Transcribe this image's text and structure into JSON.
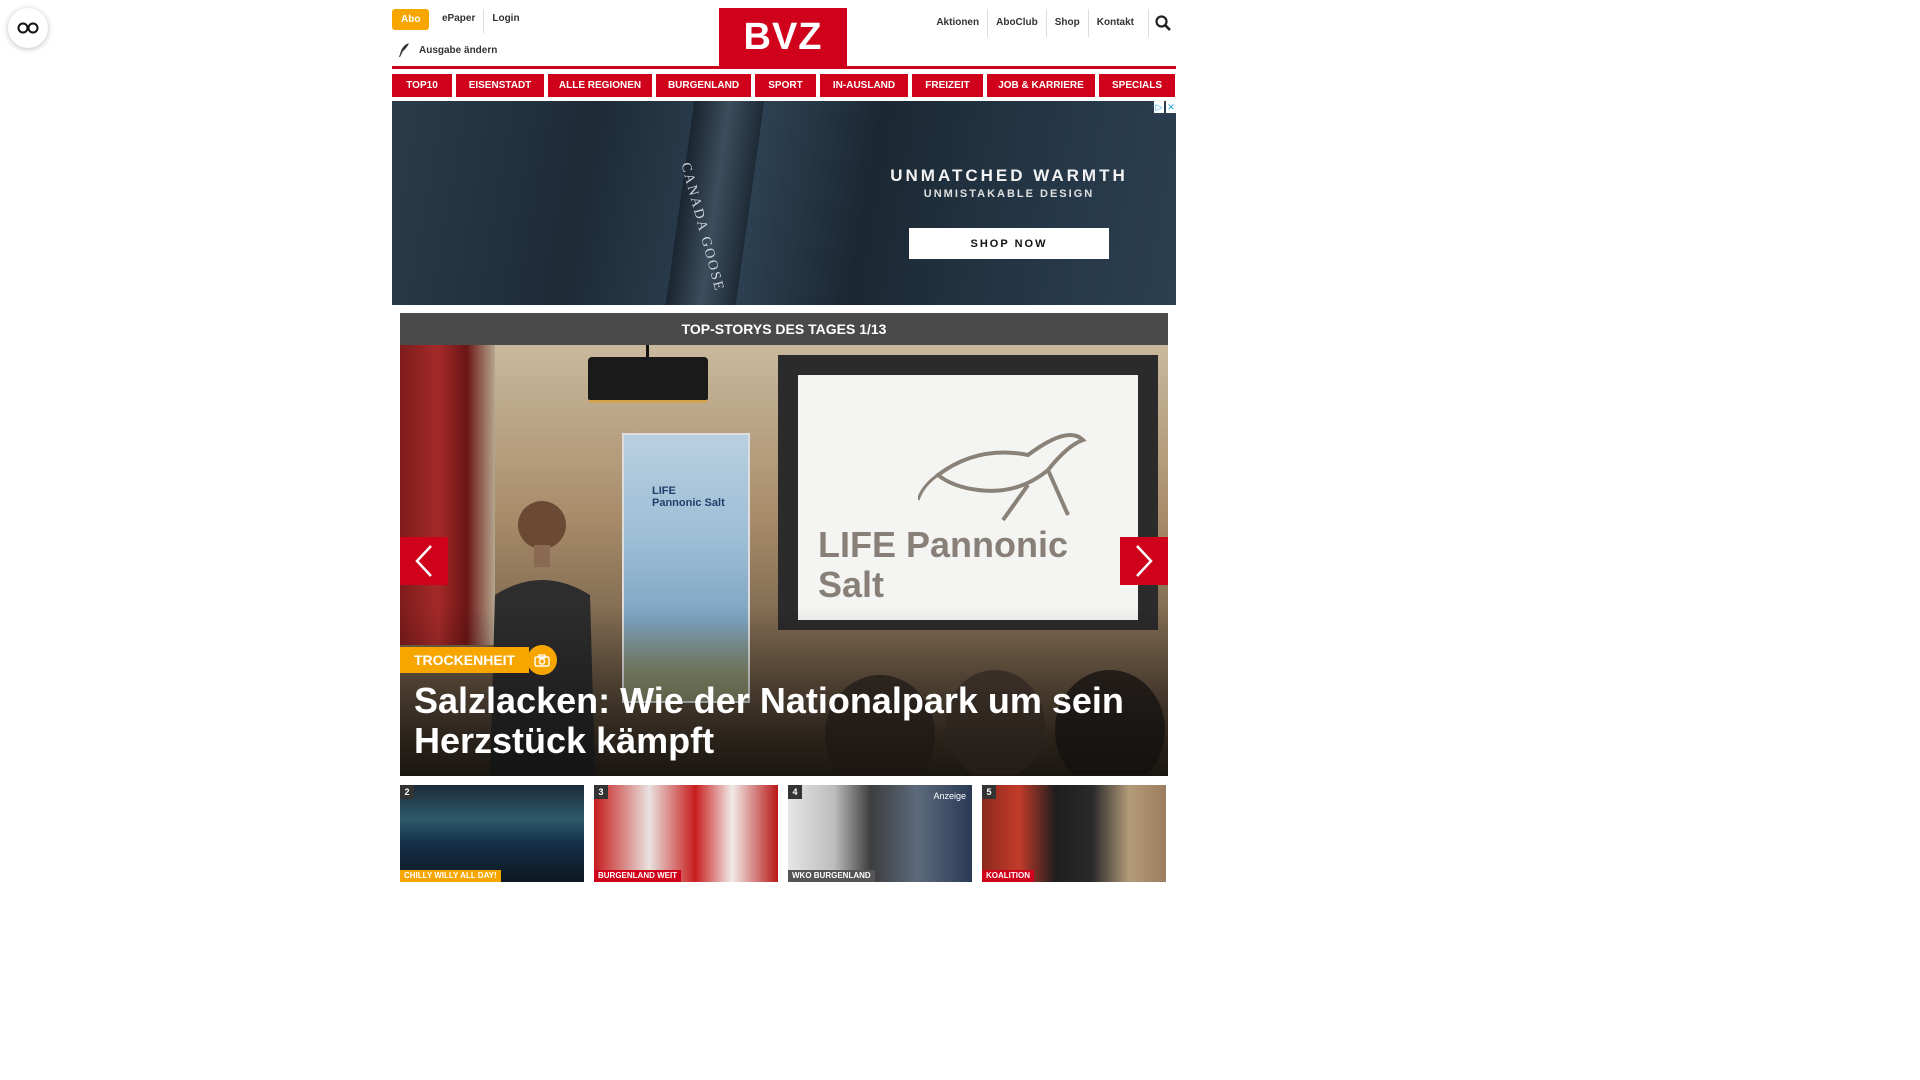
{
  "header": {
    "abo_label": "Abo",
    "epaper_label": "ePaper",
    "login_label": "Login",
    "edition_label": "Ausgabe ändern",
    "logo_text": "BVZ",
    "right_links": [
      "Aktionen",
      "AboClub",
      "Shop",
      "Kontakt"
    ]
  },
  "nav": {
    "items": [
      "TOP10",
      "EISENSTADT",
      "ALLE REGIONEN",
      "BURGENLAND",
      "SPORT",
      "IN-AUSLAND",
      "FREIZEIT",
      "JOB & KARRIERE",
      "SPECIALS"
    ]
  },
  "ad": {
    "brand": "CANADA GOOSE",
    "headline": "UNMATCHED WARMTH",
    "subline": "UNMISTAKABLE DESIGN",
    "cta": "SHOP NOW"
  },
  "stories": {
    "header": "TOP-STORYS DES TAGES 1/13",
    "hero": {
      "category": "TROCKENHEIT",
      "title": "Salzlacken: Wie der Nationalpark um sein Herzstück kämpft",
      "screen_text": "LIFE Pannonic Salt"
    },
    "thumbs": [
      {
        "num": "2",
        "category": "CHILLY WILLY ALL DAY!",
        "cat_color": "#f7a600"
      },
      {
        "num": "3",
        "category": "BURGENLAND WEIT",
        "cat_color": "#d0021b"
      },
      {
        "num": "4",
        "category": "WKO BURGENLAND",
        "cat_color": "#555555",
        "anzeige": "Anzeige"
      },
      {
        "num": "5",
        "category": "KOALITION",
        "cat_color": "#d0021b"
      }
    ]
  },
  "colors": {
    "brand_red": "#d0021b",
    "accent_orange": "#f7a600"
  }
}
